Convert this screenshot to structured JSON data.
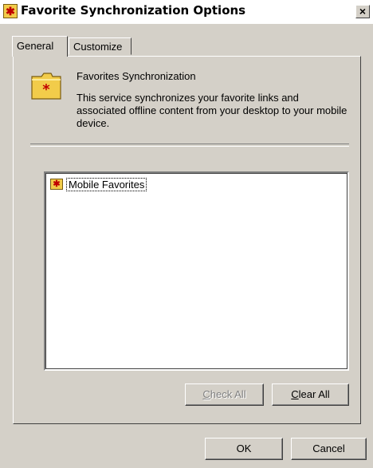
{
  "window": {
    "title": "Favorite Synchronization Options",
    "close_glyph": "×",
    "icon": "favorites-folder-icon"
  },
  "tabs": [
    {
      "label": "General",
      "active": true
    },
    {
      "label": "Customize",
      "active": false
    }
  ],
  "info": {
    "title": "Favorites Synchronization",
    "description": "This service synchronizes your favorite links and associated offline content from your desktop to your mobile device.",
    "icon": "favorites-folder-icon"
  },
  "tree": {
    "items": [
      {
        "label": "Mobile Favorites",
        "icon": "favorites-folder-icon",
        "focused": true
      }
    ]
  },
  "buttons": {
    "check_all": {
      "mnemonic": "C",
      "rest": "heck All",
      "enabled": false
    },
    "clear_all": {
      "mnemonic": "C",
      "rest": "lear All",
      "enabled": true
    },
    "ok": "OK",
    "cancel": "Cancel"
  },
  "colors": {
    "dialog_face": "#d4d0c8",
    "folder_fill": "#f2cc4a",
    "star": "#c00000"
  }
}
